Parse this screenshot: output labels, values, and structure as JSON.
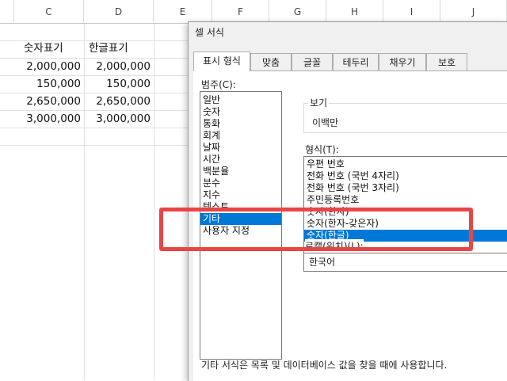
{
  "sheet": {
    "columns": [
      "C",
      "D",
      "E",
      "F",
      "G",
      "H",
      "I",
      "J"
    ],
    "headers": {
      "c": "숫자표기",
      "d": "한글표기"
    },
    "rows": [
      {
        "c": "2,000,000",
        "d": "2,000,000"
      },
      {
        "c": "150,000",
        "d": "150,000"
      },
      {
        "c": "2,650,000",
        "d": "2,650,000"
      },
      {
        "c": "3,000,000",
        "d": "3,000,000"
      }
    ]
  },
  "dialog": {
    "title": "셀 서식",
    "tabs": [
      "표시 형식",
      "맞춤",
      "글꼴",
      "테두리",
      "채우기",
      "보호"
    ],
    "active_tab": "표시 형식",
    "category_label": "범주(C):",
    "categories": [
      "일반",
      "숫자",
      "통화",
      "회계",
      "날짜",
      "시간",
      "백분율",
      "분수",
      "지수",
      "텍스트",
      "기타",
      "사용자 지정"
    ],
    "selected_category": "기타",
    "sample_label": "보기",
    "sample_value": "이백만",
    "type_label": "형식(T):",
    "types": [
      "우편 번호",
      "전화 번호 (국번 4자리)",
      "전화 번호 (국번 3자리)",
      "주민등록번호",
      "숫자(한자)",
      "숫자(한자-갖은자)",
      "숫자(한글)"
    ],
    "selected_type": "숫자(한글)",
    "locale_label": "로캘(위치)(L):",
    "locale_value": "한국어",
    "description": "기타 서식은 목록 및 데이터베이스 값을 찾을 때에 사용합니다."
  },
  "colors": {
    "accent": "#0078d7",
    "highlight": "#e84545"
  }
}
